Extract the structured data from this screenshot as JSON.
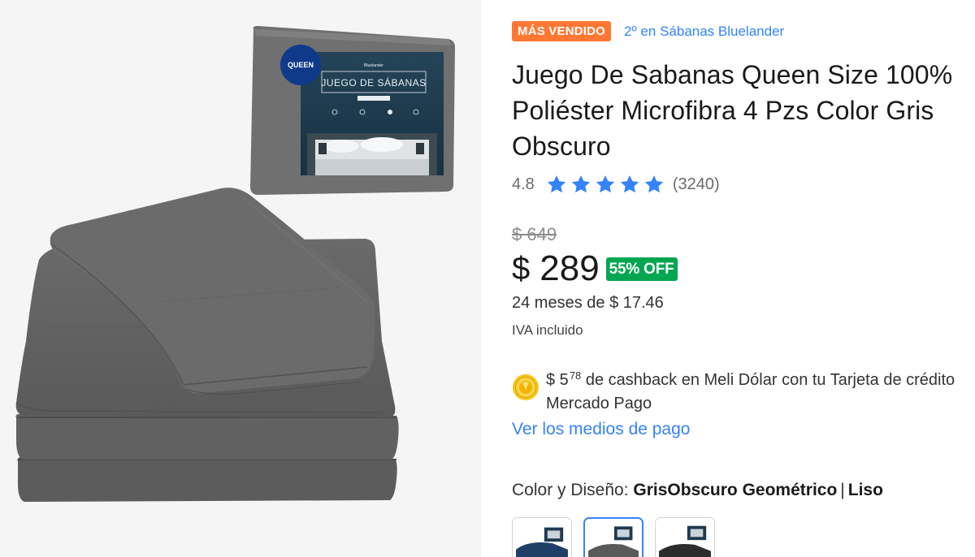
{
  "gallery": {
    "package_badge": "QUEEN",
    "package_title": "JUEGO DE SÁBANAS",
    "package_brand": "Bluelander"
  },
  "product": {
    "badge": "MÁS VENDIDO",
    "ranking_link": "2º en Sábanas Bluelander",
    "title": "Juego De Sabanas Queen Size 100% Poliéster Microfibra 4 Pzs Color Gris Obscuro",
    "rating": "4.8",
    "rating_stars": 5,
    "review_count": "(3240)"
  },
  "pricing": {
    "old_price": "$ 649",
    "currency": "$",
    "price": "289",
    "discount": "55% OFF",
    "installments": "24 meses de $ 17.46",
    "tax_note": "IVA incluido"
  },
  "cashback": {
    "amount_main": "$ 5",
    "amount_cents": "78",
    "text": " de cashback en Meli Dólar con tu Tarjeta de crédito Mercado Pago"
  },
  "payment_link": "Ver los medios de pago",
  "variant": {
    "label": "Color y Diseño: ",
    "value": "GrisObscuro Geométrico",
    "separator": "|",
    "value2": "Liso"
  },
  "swatches": [
    {
      "name": "Azul",
      "color": "#1f3f66"
    },
    {
      "name": "GrisObscuro",
      "color": "#5a5a5a"
    },
    {
      "name": "Negro",
      "color": "#2c2c2c"
    }
  ],
  "colors": {
    "accent_blue": "#3483fa",
    "badge_orange": "#ff7733",
    "discount_green": "#00a650",
    "sheet_gray": "#5f5f5f",
    "package_navy": "#1e3a4f"
  }
}
